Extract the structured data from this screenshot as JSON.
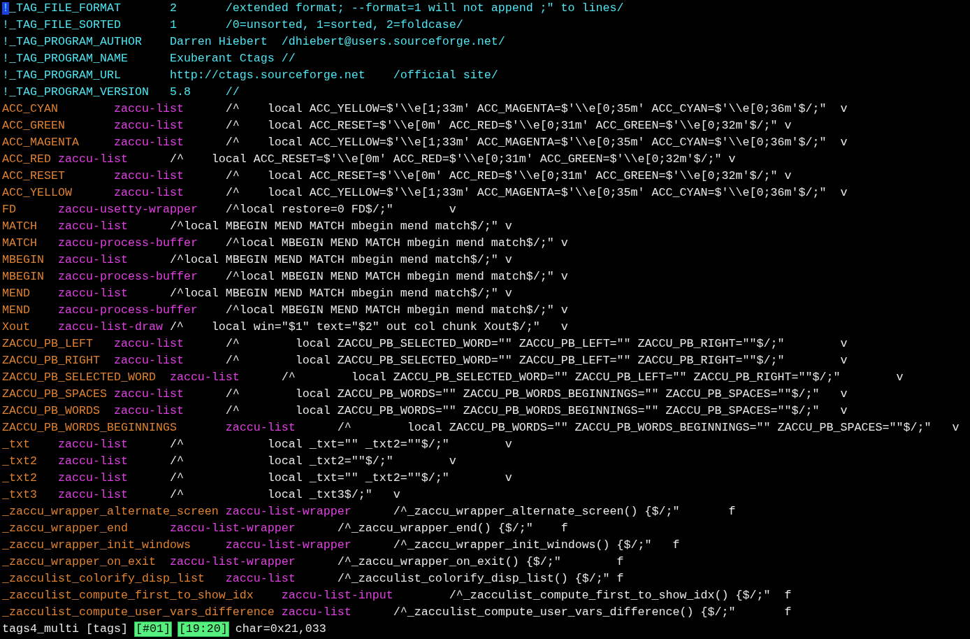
{
  "header_lines": [
    {
      "cursor": true,
      "fields": [
        "!_TAG_FILE_FORMAT",
        "2",
        "/extended format; --format=1 will not append ;\" to lines/"
      ]
    },
    {
      "cursor": false,
      "fields": [
        "!_TAG_FILE_SORTED",
        "1",
        "/0=unsorted, 1=sorted, 2=foldcase/"
      ]
    },
    {
      "cursor": false,
      "fields": [
        "!_TAG_PROGRAM_AUTHOR",
        "Darren Hiebert",
        "/dhiebert@users.sourceforge.net/"
      ]
    },
    {
      "cursor": false,
      "fields": [
        "!_TAG_PROGRAM_NAME",
        "Exuberant Ctags //"
      ]
    },
    {
      "cursor": false,
      "fields": [
        "!_TAG_PROGRAM_URL",
        "http://ctags.sourceforge.net",
        "/official site/"
      ]
    },
    {
      "cursor": false,
      "fields": [
        "!_TAG_PROGRAM_VERSION",
        "5.8",
        "//"
      ]
    }
  ],
  "tags": [
    {
      "tag": "ACC_CYAN",
      "file": "zaccu-list",
      "pattern": "/^    local ACC_YELLOW=$'\\\\e[1;33m' ACC_MAGENTA=$'\\\\e[0;35m' ACC_CYAN=$'\\\\e[0;36m'$/;\"",
      "kind": "v"
    },
    {
      "tag": "ACC_GREEN",
      "file": "zaccu-list",
      "pattern": "/^    local ACC_RESET=$'\\\\e[0m' ACC_RED=$'\\\\e[0;31m' ACC_GREEN=$'\\\\e[0;32m'$/;\"",
      "kind": "v"
    },
    {
      "tag": "ACC_MAGENTA",
      "file": "zaccu-list",
      "pattern": "/^    local ACC_YELLOW=$'\\\\e[1;33m' ACC_MAGENTA=$'\\\\e[0;35m' ACC_CYAN=$'\\\\e[0;36m'$/;\"",
      "kind": "v"
    },
    {
      "tag": "ACC_RED",
      "file": "zaccu-list",
      "pattern": "/^    local ACC_RESET=$'\\\\e[0m' ACC_RED=$'\\\\e[0;31m' ACC_GREEN=$'\\\\e[0;32m'$/;\"",
      "kind": "v"
    },
    {
      "tag": "ACC_RESET",
      "file": "zaccu-list",
      "pattern": "/^    local ACC_RESET=$'\\\\e[0m' ACC_RED=$'\\\\e[0;31m' ACC_GREEN=$'\\\\e[0;32m'$/;\"",
      "kind": "v"
    },
    {
      "tag": "ACC_YELLOW",
      "file": "zaccu-list",
      "pattern": "/^    local ACC_YELLOW=$'\\\\e[1;33m' ACC_MAGENTA=$'\\\\e[0;35m' ACC_CYAN=$'\\\\e[0;36m'$/;\"",
      "kind": "v"
    },
    {
      "tag": "FD",
      "file": "zaccu-usetty-wrapper",
      "pattern": "/^local restore=0 FD$/;\"",
      "kind": "v"
    },
    {
      "tag": "MATCH",
      "file": "zaccu-list",
      "pattern": "/^local MBEGIN MEND MATCH mbegin mend match$/;\"",
      "kind": "v"
    },
    {
      "tag": "MATCH",
      "file": "zaccu-process-buffer",
      "pattern": "/^local MBEGIN MEND MATCH mbegin mend match$/;\"",
      "kind": "v"
    },
    {
      "tag": "MBEGIN",
      "file": "zaccu-list",
      "pattern": "/^local MBEGIN MEND MATCH mbegin mend match$/;\"",
      "kind": "v"
    },
    {
      "tag": "MBEGIN",
      "file": "zaccu-process-buffer",
      "pattern": "/^local MBEGIN MEND MATCH mbegin mend match$/;\"",
      "kind": "v"
    },
    {
      "tag": "MEND",
      "file": "zaccu-list",
      "pattern": "/^local MBEGIN MEND MATCH mbegin mend match$/;\"",
      "kind": "v"
    },
    {
      "tag": "MEND",
      "file": "zaccu-process-buffer",
      "pattern": "/^local MBEGIN MEND MATCH mbegin mend match$/;\"",
      "kind": "v"
    },
    {
      "tag": "Xout",
      "file": "zaccu-list-draw",
      "pattern": "/^    local win=\"$1\" text=\"$2\" out col chunk Xout$/;\"",
      "kind": "v"
    },
    {
      "tag": "ZACCU_PB_LEFT",
      "file": "zaccu-list",
      "pattern": "/^        local ZACCU_PB_SELECTED_WORD=\"\" ZACCU_PB_LEFT=\"\" ZACCU_PB_RIGHT=\"\"$/;\"",
      "kind": "v"
    },
    {
      "tag": "ZACCU_PB_RIGHT",
      "file": "zaccu-list",
      "pattern": "/^        local ZACCU_PB_SELECTED_WORD=\"\" ZACCU_PB_LEFT=\"\" ZACCU_PB_RIGHT=\"\"$/;\"",
      "kind": "v"
    },
    {
      "tag": "ZACCU_PB_SELECTED_WORD",
      "file": "zaccu-list",
      "pattern": "/^        local ZACCU_PB_SELECTED_WORD=\"\" ZACCU_PB_LEFT=\"\" ZACCU_PB_RIGHT=\"\"$/;\"",
      "kind": "v"
    },
    {
      "tag": "ZACCU_PB_SPACES",
      "file": "zaccu-list",
      "pattern": "/^        local ZACCU_PB_WORDS=\"\" ZACCU_PB_WORDS_BEGINNINGS=\"\" ZACCU_PB_SPACES=\"\"$/;\"",
      "kind": "v"
    },
    {
      "tag": "ZACCU_PB_WORDS",
      "file": "zaccu-list",
      "pattern": "/^        local ZACCU_PB_WORDS=\"\" ZACCU_PB_WORDS_BEGINNINGS=\"\" ZACCU_PB_SPACES=\"\"$/;\"",
      "kind": "v"
    },
    {
      "tag": "ZACCU_PB_WORDS_BEGINNINGS",
      "file": "zaccu-list",
      "pattern": "/^        local ZACCU_PB_WORDS=\"\" ZACCU_PB_WORDS_BEGINNINGS=\"\" ZACCU_PB_SPACES=\"\"$/;\"",
      "kind": "v"
    },
    {
      "tag": "_txt",
      "file": "zaccu-list",
      "pattern": "/^            local _txt=\"\" _txt2=\"\"$/;\"",
      "kind": "v"
    },
    {
      "tag": "_txt2",
      "file": "zaccu-list",
      "pattern": "/^            local _txt2=\"\"$/;\"",
      "kind": "v"
    },
    {
      "tag": "_txt2",
      "file": "zaccu-list",
      "pattern": "/^            local _txt=\"\" _txt2=\"\"$/;\"",
      "kind": "v"
    },
    {
      "tag": "_txt3",
      "file": "zaccu-list",
      "pattern": "/^            local _txt3$/;\"",
      "kind": "v"
    },
    {
      "tag": "_zaccu_wrapper_alternate_screen",
      "file": "zaccu-list-wrapper",
      "pattern": "/^_zaccu_wrapper_alternate_screen() {$/;\"",
      "kind": "f"
    },
    {
      "tag": "_zaccu_wrapper_end",
      "file": "zaccu-list-wrapper",
      "pattern": "/^_zaccu_wrapper_end() {$/;\"",
      "kind": "f"
    },
    {
      "tag": "_zaccu_wrapper_init_windows",
      "file": "zaccu-list-wrapper",
      "pattern": "/^_zaccu_wrapper_init_windows() {$/;\"",
      "kind": "f"
    },
    {
      "tag": "_zaccu_wrapper_on_exit",
      "file": "zaccu-list-wrapper",
      "pattern": "/^_zaccu_wrapper_on_exit() {$/;\"",
      "kind": "f"
    },
    {
      "tag": "_zacculist_colorify_disp_list",
      "file": "zaccu-list",
      "pattern": "/^_zacculist_colorify_disp_list() {$/;\"",
      "kind": "f"
    },
    {
      "tag": "_zacculist_compute_first_to_show_idx",
      "file": "zaccu-list-input",
      "pattern": "/^_zacculist_compute_first_to_show_idx() {$/;\"",
      "kind": "f"
    },
    {
      "tag": "_zacculist_compute_user_vars_difference",
      "file": "zaccu-list",
      "pattern": "/^_zacculist_compute_user_vars_difference() {$/;\"",
      "kind": "f"
    }
  ],
  "status_bar": [
    {
      "text": "tags4_multi",
      "highlighted": false
    },
    {
      "text": "[tags]",
      "highlighted": false
    },
    {
      "text": "[#01]",
      "highlighted": true
    },
    {
      "text": "[19:20]",
      "highlighted": true
    },
    {
      "text": "char=0x21,033",
      "highlighted": false
    }
  ]
}
